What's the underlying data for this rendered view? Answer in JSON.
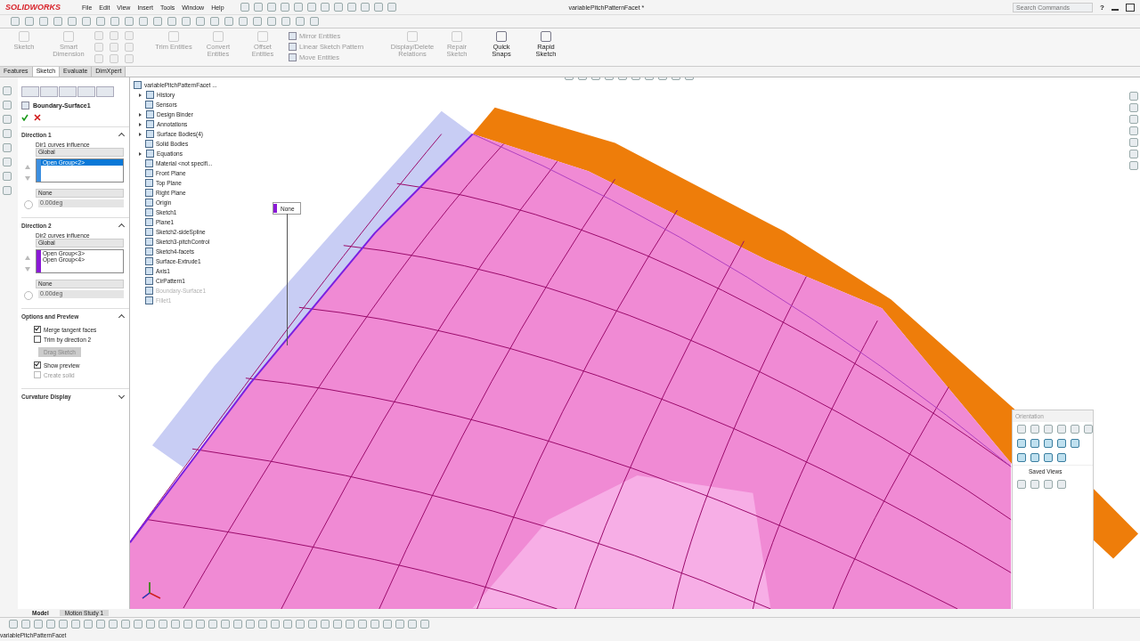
{
  "title_bar": {
    "logo": "SOLIDWORKS",
    "menu": [
      "File",
      "Edit",
      "View",
      "Insert",
      "Tools",
      "Window",
      "Help"
    ],
    "title": "variablePitchPatternFacet *",
    "search": {
      "placeholder": "Search Commands"
    },
    "help": "?"
  },
  "command_manager": {
    "buttons": [
      {
        "kind": "large",
        "label": "Sketch",
        "disabled": true
      },
      {
        "kind": "large",
        "label": "Smart Dimension",
        "disabled": true
      },
      {
        "kind": "grid",
        "disabled": true
      },
      {
        "kind": "large",
        "label": "Trim Entities",
        "disabled": true
      },
      {
        "kind": "large",
        "label": "Convert Entities",
        "disabled": true
      },
      {
        "kind": "large",
        "label": "Offset Entities",
        "disabled": true
      },
      {
        "kind": "small",
        "label": "Mirror Entities",
        "disabled": true
      },
      {
        "kind": "small",
        "label": "Linear Sketch Pattern",
        "disabled": true
      },
      {
        "kind": "small",
        "label": "Move Entities",
        "disabled": true
      },
      {
        "kind": "large",
        "label": "Display/Delete Relations",
        "disabled": true
      },
      {
        "kind": "large",
        "label": "Repair Sketch",
        "disabled": true
      },
      {
        "kind": "large",
        "label": "Quick Snaps",
        "disabled": false
      },
      {
        "kind": "large",
        "label": "Rapid Sketch",
        "disabled": false
      }
    ],
    "tabs": [
      {
        "label": "Features",
        "selected": false
      },
      {
        "label": "Sketch",
        "selected": true
      },
      {
        "label": "Evaluate",
        "selected": false
      },
      {
        "label": "DimXpert",
        "selected": false
      }
    ]
  },
  "property_manager": {
    "title": "Boundary-Surface1",
    "sections": [
      {
        "kind": "direction",
        "title": "Direction 1",
        "expanded": true,
        "influence_label": "Dir1 curves influence",
        "influence": "Global",
        "color": "#3c8fe0",
        "curves": [
          {
            "label": "Open Group<2>",
            "selected": true
          }
        ],
        "tangency": "None",
        "angle": "0.00deg"
      },
      {
        "kind": "direction",
        "title": "Direction 2",
        "expanded": true,
        "influence_label": "Dir2 curves influence",
        "influence": "Global",
        "color": "#8a19d6",
        "curves": [
          {
            "label": "Open Group<3>",
            "selected": false
          },
          {
            "label": "Open Group<4>",
            "selected": false
          }
        ],
        "tangency": "None",
        "angle": "0.00deg"
      },
      {
        "kind": "options",
        "title": "Options and Preview",
        "expanded": true,
        "items": [
          {
            "kind": "check",
            "label": "Merge tangent faces",
            "checked": true,
            "disabled": false
          },
          {
            "kind": "check",
            "label": "Trim by direction 2",
            "checked": false,
            "disabled": false
          },
          {
            "kind": "button",
            "label": "Drag Sketch",
            "disabled": true
          },
          {
            "kind": "check",
            "label": "Show preview",
            "checked": true,
            "disabled": false
          },
          {
            "kind": "check",
            "label": "Create solid",
            "checked": false,
            "disabled": true
          }
        ]
      },
      {
        "kind": "options",
        "title": "Curvature Display",
        "expanded": false
      }
    ]
  },
  "feature_tree": {
    "root": "variablePitchPatternFacet ...",
    "items": [
      {
        "label": "History",
        "expandable": true,
        "greyed": false
      },
      {
        "label": "Sensors",
        "expandable": false,
        "greyed": false
      },
      {
        "label": "Design Binder",
        "expandable": true,
        "greyed": false
      },
      {
        "label": "Annotations",
        "expandable": true,
        "greyed": false
      },
      {
        "label": "Surface Bodies(4)",
        "expandable": true,
        "greyed": false
      },
      {
        "label": "Solid Bodies",
        "expandable": false,
        "greyed": false
      },
      {
        "label": "Equations",
        "expandable": true,
        "greyed": false
      },
      {
        "label": "Material <not specifi...",
        "expandable": false,
        "greyed": false
      },
      {
        "label": "Front Plane",
        "expandable": false,
        "greyed": false
      },
      {
        "label": "Top Plane",
        "expandable": false,
        "greyed": false
      },
      {
        "label": "Right Plane",
        "expandable": false,
        "greyed": false
      },
      {
        "label": "Origin",
        "expandable": false,
        "greyed": false
      },
      {
        "label": "Sketch1",
        "expandable": false,
        "greyed": false
      },
      {
        "label": "Plane1",
        "expandable": false,
        "greyed": false
      },
      {
        "label": "Sketch2-sideSpline",
        "expandable": false,
        "greyed": false
      },
      {
        "label": "Sketch3-pitchControl",
        "expandable": false,
        "greyed": false
      },
      {
        "label": "Sketch4-facets",
        "expandable": false,
        "greyed": false
      },
      {
        "label": "Surface-Extrude1",
        "expandable": false,
        "greyed": false
      },
      {
        "label": "Axis1",
        "expandable": false,
        "greyed": false
      },
      {
        "label": "CirPattern1",
        "expandable": false,
        "greyed": false
      },
      {
        "label": "Boundary-Surface1",
        "expandable": false,
        "greyed": true
      },
      {
        "label": "Fillet1",
        "expandable": false,
        "greyed": true
      }
    ]
  },
  "viewport": {
    "callout": {
      "label": "None",
      "color": "#8a19d6"
    }
  },
  "orientation_panel": {
    "title": "Orientation",
    "saved_views": "Saved Views"
  },
  "bottom": {
    "tabs": [
      {
        "label": "Model",
        "selected": true
      },
      {
        "label": "Motion Study 1",
        "selected": false
      }
    ],
    "status": "variablePitchPatternFacet"
  }
}
